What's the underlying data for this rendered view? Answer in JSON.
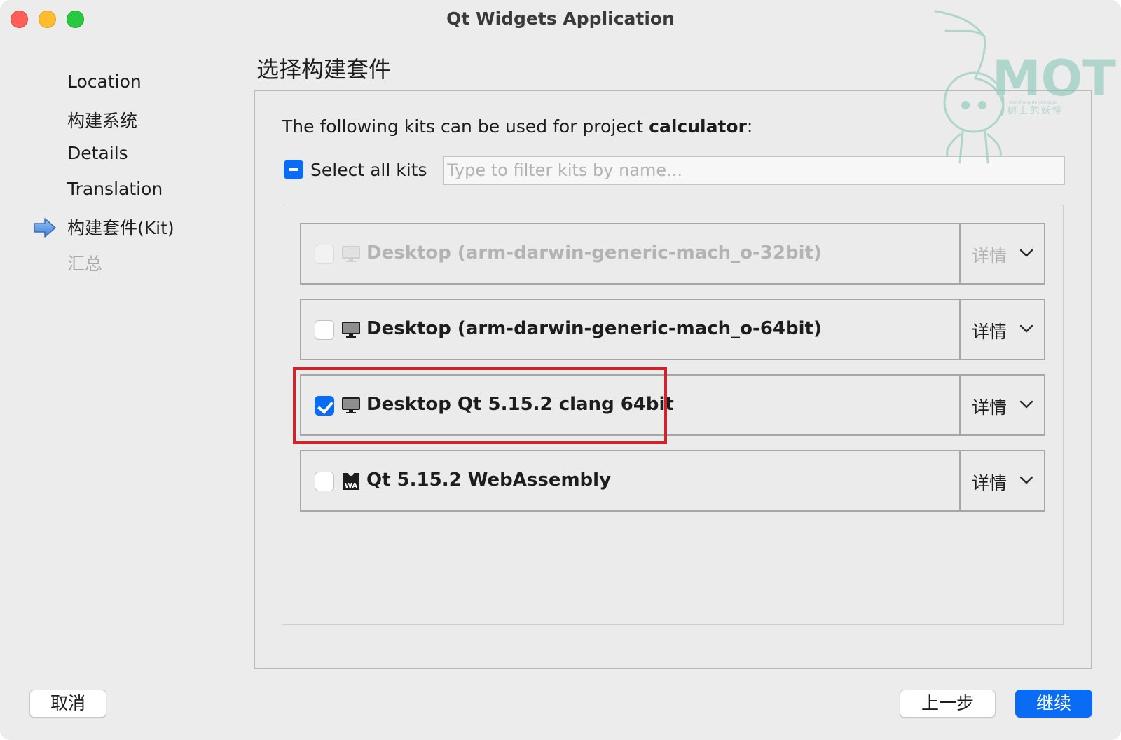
{
  "window": {
    "title": "Qt Widgets Application"
  },
  "sidebar": {
    "steps": [
      {
        "label": "Location",
        "state": "done"
      },
      {
        "label": "构建系统",
        "state": "done"
      },
      {
        "label": "Details",
        "state": "done"
      },
      {
        "label": "Translation",
        "state": "done"
      },
      {
        "label": "构建套件(Kit)",
        "state": "current"
      },
      {
        "label": "汇总",
        "state": "pending"
      }
    ],
    "current_indicator_icon": "arrow-right-icon"
  },
  "page": {
    "title": "选择构建套件",
    "intro_prefix": "The following kits can be used for project ",
    "project_name": "calculator",
    "intro_suffix": ":",
    "select_all_label": "Select all kits",
    "select_all_state": "partial",
    "filter": {
      "value": "",
      "placeholder": "Type to filter kits by name..."
    }
  },
  "kits": [
    {
      "name": "Desktop (arm-darwin-generic-mach_o-32bit)",
      "checked": false,
      "enabled": false,
      "icon": "desktop-monitor-icon",
      "details_label": "详情"
    },
    {
      "name": "Desktop (arm-darwin-generic-mach_o-64bit)",
      "checked": false,
      "enabled": true,
      "icon": "desktop-monitor-icon",
      "details_label": "详情"
    },
    {
      "name": "Desktop Qt 5.15.2 clang 64bit",
      "checked": true,
      "enabled": true,
      "icon": "desktop-monitor-icon",
      "details_label": "详情",
      "highlighted": true
    },
    {
      "name": "Qt 5.15.2 WebAssembly",
      "checked": false,
      "enabled": true,
      "icon": "webassembly-icon",
      "details_label": "详情"
    }
  ],
  "footer": {
    "cancel_label": "取消",
    "back_label": "上一步",
    "next_label": "继续"
  },
  "watermark": {
    "logo_text": "MOT",
    "caption": "树上的妖怪",
    "pinyin": "shù shàng de yāo guài"
  },
  "colors": {
    "accent": "#0a6cf5",
    "highlight_border": "#d2232a",
    "watermark": "#7ec4b4"
  }
}
